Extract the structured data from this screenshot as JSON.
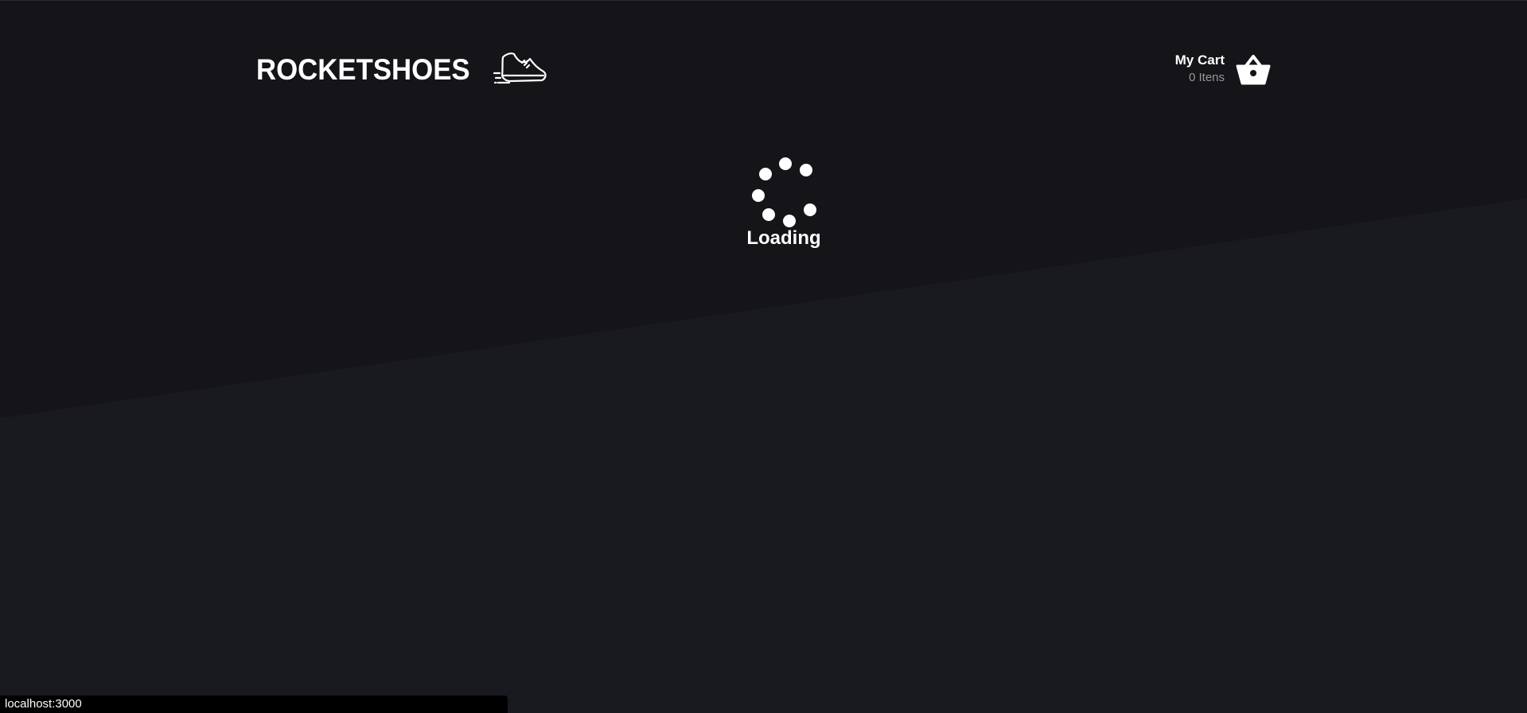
{
  "header": {
    "logo_text": "ROCKETSHOES",
    "logo_icon": "running-shoe-icon",
    "cart": {
      "title": "My Cart",
      "count": "0 Itens",
      "icon": "basket-icon"
    }
  },
  "loader": {
    "text": "Loading"
  },
  "status_bar": {
    "url": "localhost:3000"
  },
  "colors": {
    "background_top": "#141419",
    "background_bottom": "#191920",
    "text_primary": "#ffffff",
    "text_secondary": "#999999"
  }
}
